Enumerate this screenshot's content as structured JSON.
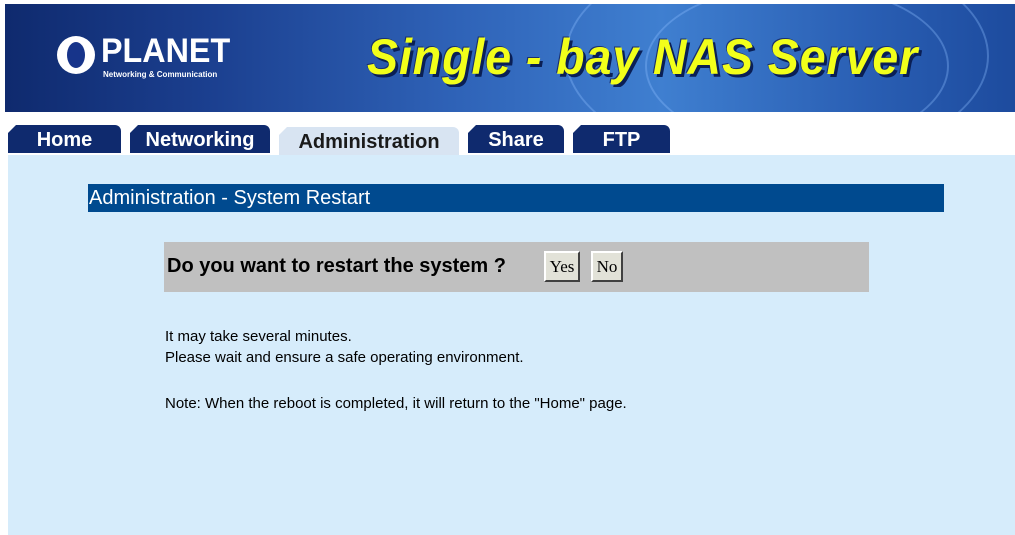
{
  "banner": {
    "logo_name": "PLANET",
    "logo_tagline": "Networking & Communication",
    "product_title": "Single - bay NAS Server"
  },
  "nav": {
    "tabs": [
      {
        "label": "Home",
        "active": false
      },
      {
        "label": "Networking",
        "active": false
      },
      {
        "label": "Administration",
        "active": true
      },
      {
        "label": "Share",
        "active": false
      },
      {
        "label": "FTP",
        "active": false
      }
    ]
  },
  "main": {
    "section_title": "Administration - System Restart",
    "question": "Do you want to restart the system ?",
    "yes_label": "Yes",
    "no_label": "No",
    "info_lines": [
      "It may take several minutes.",
      "Please wait and ensure a safe operating environment.",
      "Note: When the reboot is completed, it will return to the \"Home\" page."
    ]
  },
  "colors": {
    "banner_dark": "#0f2a6e",
    "title_yellow": "#f2ff1a",
    "tab_navy": "#0f2a6e",
    "tab_active": "#d8e4f2",
    "content_bg": "#d6ecfb",
    "section_header": "#004a8f",
    "confirm_bar": "#c0c0c0"
  }
}
